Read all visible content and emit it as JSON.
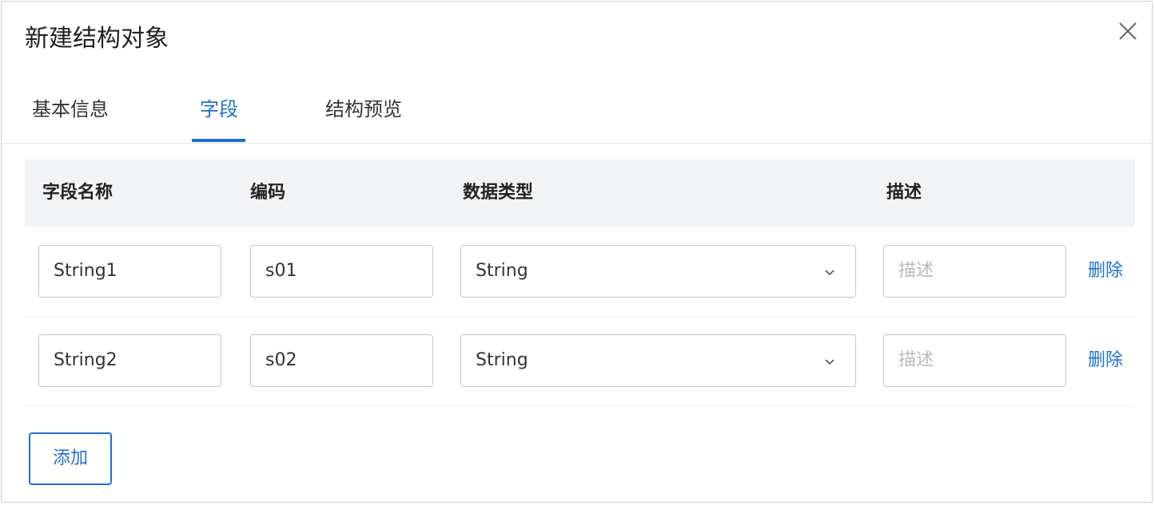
{
  "dialog": {
    "title": "新建结构对象"
  },
  "tabs": [
    {
      "label": "基本信息",
      "active": false
    },
    {
      "label": "字段",
      "active": true
    },
    {
      "label": "结构预览",
      "active": false
    }
  ],
  "table": {
    "headers": [
      "字段名称",
      "编码",
      "数据类型",
      "描述"
    ],
    "rows": [
      {
        "name": "String1",
        "code": "s01",
        "type": "String",
        "description_placeholder": "描述",
        "delete_label": "删除"
      },
      {
        "name": "String2",
        "code": "s02",
        "type": "String",
        "description_placeholder": "描述",
        "delete_label": "删除"
      }
    ]
  },
  "actions": {
    "add_label": "添加"
  },
  "icons": {
    "close": "close-icon",
    "select_arrow": "chevron-down-icon"
  },
  "colors": {
    "accent": "#1f6fd1",
    "header_bg": "#f2f3f5",
    "border": "#c6c6c6",
    "placeholder": "#b9b9b9"
  }
}
